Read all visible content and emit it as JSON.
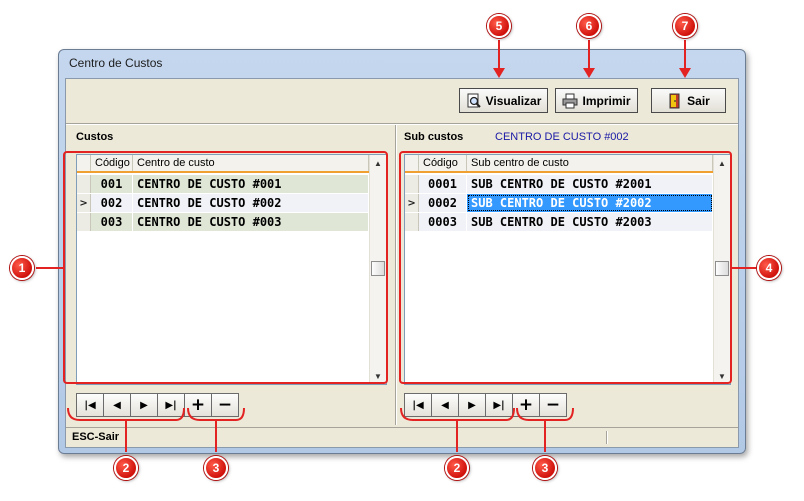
{
  "window": {
    "title": "Centro de Custos"
  },
  "toolbar": {
    "visualizar": {
      "label": "Visualizar",
      "icon": "magnifier-document-icon"
    },
    "imprimir": {
      "label": "Imprimir",
      "icon": "printer-icon"
    },
    "sair": {
      "label": "Sair",
      "icon": "exit-door-icon"
    }
  },
  "custos": {
    "title": "Custos",
    "columns": [
      "Código",
      "Centro de custo"
    ],
    "rows": [
      {
        "code": "001",
        "name": "CENTRO DE CUSTO #001"
      },
      {
        "code": "002",
        "name": "CENTRO DE CUSTO #002"
      },
      {
        "code": "003",
        "name": "CENTRO DE CUSTO #003"
      }
    ],
    "current_row_indicator": ">"
  },
  "subcustos": {
    "title": "Sub custos",
    "current_centro": "CENTRO DE CUSTO #002",
    "columns": [
      "Código",
      "Sub centro de custo"
    ],
    "rows": [
      {
        "code": "0001",
        "name": "SUB CENTRO DE CUSTO #2001"
      },
      {
        "code": "0002",
        "name": "SUB CENTRO DE CUSTO #2002"
      },
      {
        "code": "0003",
        "name": "SUB CENTRO DE CUSTO #2003"
      }
    ],
    "current_row_indicator": ">"
  },
  "nav_buttons": {
    "first": "|◀",
    "prev": "◀",
    "next": "▶",
    "last": "▶|",
    "add": "+",
    "remove": "−"
  },
  "statusbar": {
    "text": "ESC-Sair"
  },
  "annotations": [
    "1",
    "2",
    "3",
    "4",
    "5",
    "6",
    "7",
    "2",
    "3"
  ],
  "colors": {
    "annotation_red": "#e32222",
    "selected_row": "#3399ff",
    "grid_header_line": "#f0a030",
    "subtitle_blue": "#1a1aa6"
  }
}
